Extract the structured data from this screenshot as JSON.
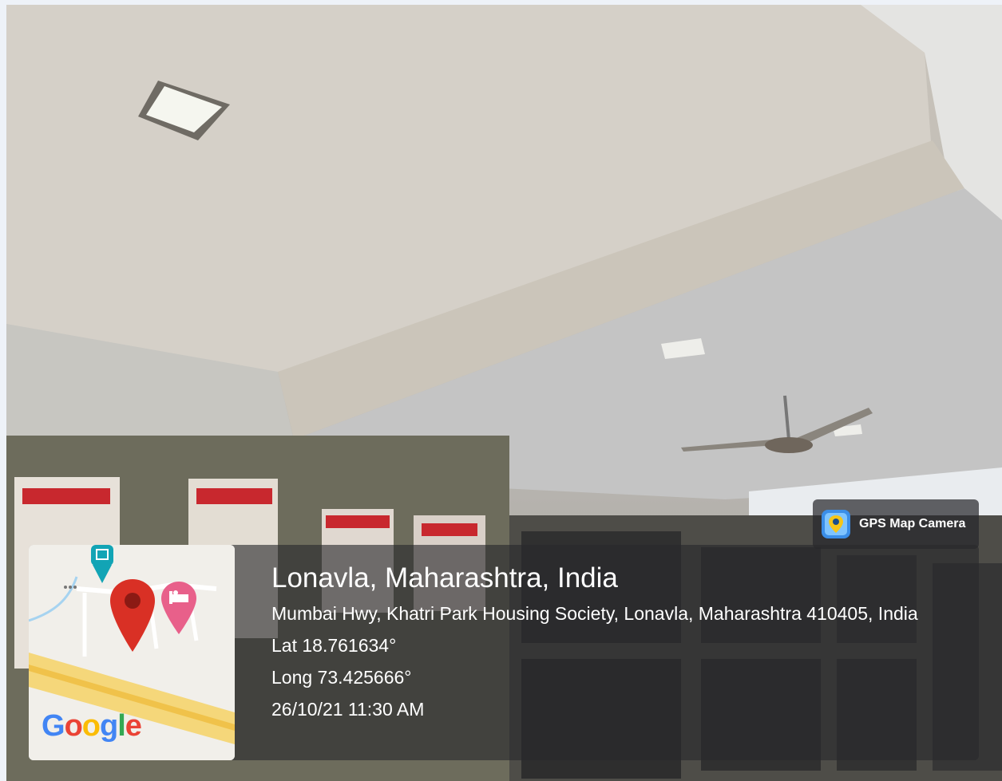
{
  "badge": {
    "app_name": "GPS Map Camera",
    "icon": "map-pin-camera-icon"
  },
  "location": {
    "title": "Lonavla, Maharashtra, India",
    "address": "Mumbai Hwy, Khatri Park Housing Society, Lonavla, Maharashtra 410405, India",
    "lat": "Lat 18.761634°",
    "long": "Long 73.425666°",
    "datetime": "26/10/21 11:30 AM"
  },
  "map": {
    "brand": [
      "G",
      "o",
      "o",
      "g",
      "l",
      "e"
    ],
    "brand_colors": [
      "#4285F4",
      "#EA4335",
      "#FBBC05",
      "#4285F4",
      "#34A853",
      "#EA4335"
    ],
    "icons": [
      "map-marker-icon",
      "hotel-marker-icon",
      "poi-marker-icon"
    ]
  },
  "colors": {
    "overlay": "#28282c",
    "marker_red": "#d93025",
    "hotel_pink": "#e8608a",
    "poi_teal": "#12a4b5"
  }
}
